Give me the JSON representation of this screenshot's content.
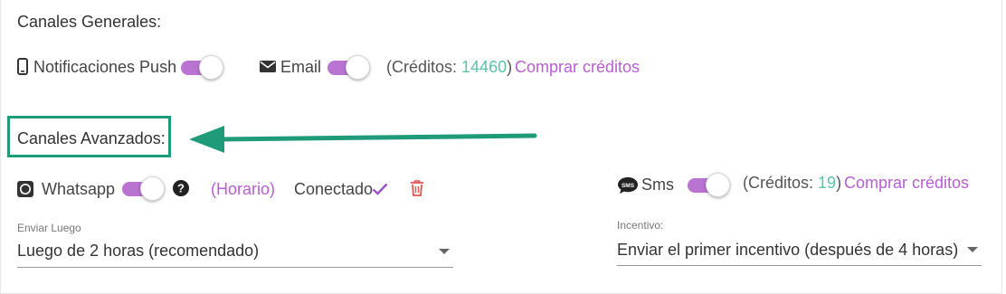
{
  "general": {
    "title": "Canales Generales:",
    "push_label": "Notificaciones Push",
    "email_label": "Email",
    "credits_prefix": "(Créditos: ",
    "credits_value": "14460",
    "credits_suffix": ")",
    "buy_link": "Comprar créditos"
  },
  "advanced": {
    "title": "Canales Avanzados:",
    "whatsapp_label": "Whatsapp",
    "schedule_link": "(Horario)",
    "connected_label": "Conectado",
    "sms_label": "Sms",
    "sms_credits_prefix": "(Créditos: ",
    "sms_credits_value": "19",
    "sms_credits_suffix": ")",
    "sms_buy_link": "Comprar créditos"
  },
  "send_after": {
    "label": "Enviar Luego",
    "value": "Luego de 2 horas (recomendado)"
  },
  "incentive": {
    "label": "Incentivo:",
    "value": "Enviar el primer incentivo (después de 4 horas)"
  },
  "toggles": {
    "push": true,
    "email": true,
    "whatsapp": true,
    "sms": true
  },
  "colors": {
    "accent": "#b974d1",
    "link": "#b65fd1",
    "credits": "#5cc3a3",
    "annotation": "#1f9b7a",
    "delete": "#e05555"
  }
}
